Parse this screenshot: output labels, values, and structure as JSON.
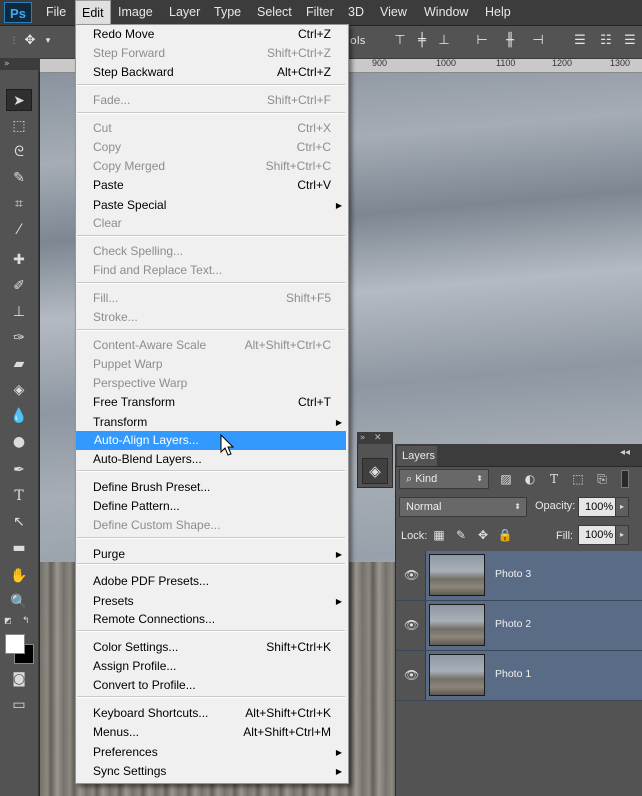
{
  "app": {
    "logo": "Ps",
    "menus": [
      "File",
      "Edit",
      "Image",
      "Layer",
      "Type",
      "Select",
      "Filter",
      "3D",
      "View",
      "Window",
      "Help"
    ],
    "active_menu": "Edit"
  },
  "options_bar": {
    "partial_text": "ols"
  },
  "ruler": {
    "ticks": [
      "900",
      "1000",
      "1100",
      "1200",
      "1300"
    ]
  },
  "vertical_ruler_digits": [
    "1",
    "9",
    "0",
    "0"
  ],
  "edit_menu": {
    "groups": [
      [
        {
          "label": "Redo Move",
          "shortcut": "Ctrl+Z",
          "enabled": true
        },
        {
          "label": "Step Forward",
          "shortcut": "Shift+Ctrl+Z",
          "enabled": false
        },
        {
          "label": "Step Backward",
          "shortcut": "Alt+Ctrl+Z",
          "enabled": true
        }
      ],
      [
        {
          "label": "Fade...",
          "shortcut": "Shift+Ctrl+F",
          "enabled": false
        }
      ],
      [
        {
          "label": "Cut",
          "shortcut": "Ctrl+X",
          "enabled": false
        },
        {
          "label": "Copy",
          "shortcut": "Ctrl+C",
          "enabled": false
        },
        {
          "label": "Copy Merged",
          "shortcut": "Shift+Ctrl+C",
          "enabled": false
        },
        {
          "label": "Paste",
          "shortcut": "Ctrl+V",
          "enabled": true
        },
        {
          "label": "Paste Special",
          "shortcut": "",
          "enabled": true,
          "submenu": true
        },
        {
          "label": "Clear",
          "shortcut": "",
          "enabled": false
        }
      ],
      [
        {
          "label": "Check Spelling...",
          "shortcut": "",
          "enabled": false
        },
        {
          "label": "Find and Replace Text...",
          "shortcut": "",
          "enabled": false
        }
      ],
      [
        {
          "label": "Fill...",
          "shortcut": "Shift+F5",
          "enabled": false
        },
        {
          "label": "Stroke...",
          "shortcut": "",
          "enabled": false
        }
      ],
      [
        {
          "label": "Content-Aware Scale",
          "shortcut": "Alt+Shift+Ctrl+C",
          "enabled": false
        },
        {
          "label": "Puppet Warp",
          "shortcut": "",
          "enabled": false
        },
        {
          "label": "Perspective Warp",
          "shortcut": "",
          "enabled": false
        },
        {
          "label": "Free Transform",
          "shortcut": "Ctrl+T",
          "enabled": true
        },
        {
          "label": "Transform",
          "shortcut": "",
          "enabled": true,
          "submenu": true
        },
        {
          "label": "Auto-Align Layers...",
          "shortcut": "",
          "enabled": true,
          "highlighted": true
        },
        {
          "label": "Auto-Blend Layers...",
          "shortcut": "",
          "enabled": true
        }
      ],
      [
        {
          "label": "Define Brush Preset...",
          "shortcut": "",
          "enabled": true
        },
        {
          "label": "Define Pattern...",
          "shortcut": "",
          "enabled": true
        },
        {
          "label": "Define Custom Shape...",
          "shortcut": "",
          "enabled": false
        }
      ],
      [
        {
          "label": "Purge",
          "shortcut": "",
          "enabled": true,
          "submenu": true
        }
      ],
      [
        {
          "label": "Adobe PDF Presets...",
          "shortcut": "",
          "enabled": true
        },
        {
          "label": "Presets",
          "shortcut": "",
          "enabled": true,
          "submenu": true
        },
        {
          "label": "Remote Connections...",
          "shortcut": "",
          "enabled": true
        }
      ],
      [
        {
          "label": "Color Settings...",
          "shortcut": "Shift+Ctrl+K",
          "enabled": true
        },
        {
          "label": "Assign Profile...",
          "shortcut": "",
          "enabled": true
        },
        {
          "label": "Convert to Profile...",
          "shortcut": "",
          "enabled": true
        }
      ],
      [
        {
          "label": "Keyboard Shortcuts...",
          "shortcut": "Alt+Shift+Ctrl+K",
          "enabled": true
        },
        {
          "label": "Menus...",
          "shortcut": "Alt+Shift+Ctrl+M",
          "enabled": true
        },
        {
          "label": "Preferences",
          "shortcut": "",
          "enabled": true,
          "submenu": true
        },
        {
          "label": "Sync Settings",
          "shortcut": "",
          "enabled": true,
          "submenu": true
        }
      ]
    ]
  },
  "layers_panel": {
    "tab_label": "Layers",
    "filter_kind": "Kind",
    "blend_mode": "Normal",
    "opacity_label": "Opacity:",
    "opacity_value": "100%",
    "lock_label": "Lock:",
    "fill_label": "Fill:",
    "fill_value": "100%",
    "layers": [
      {
        "name": "Photo 3",
        "visible": true,
        "selected": true
      },
      {
        "name": "Photo 2",
        "visible": true,
        "selected": true
      },
      {
        "name": "Photo 1",
        "visible": true,
        "selected": true
      }
    ]
  },
  "colors": {
    "menu_highlight": "#3399ff",
    "ps_blue": "#3fa9f5",
    "layer_selected": "#5a6b86"
  }
}
